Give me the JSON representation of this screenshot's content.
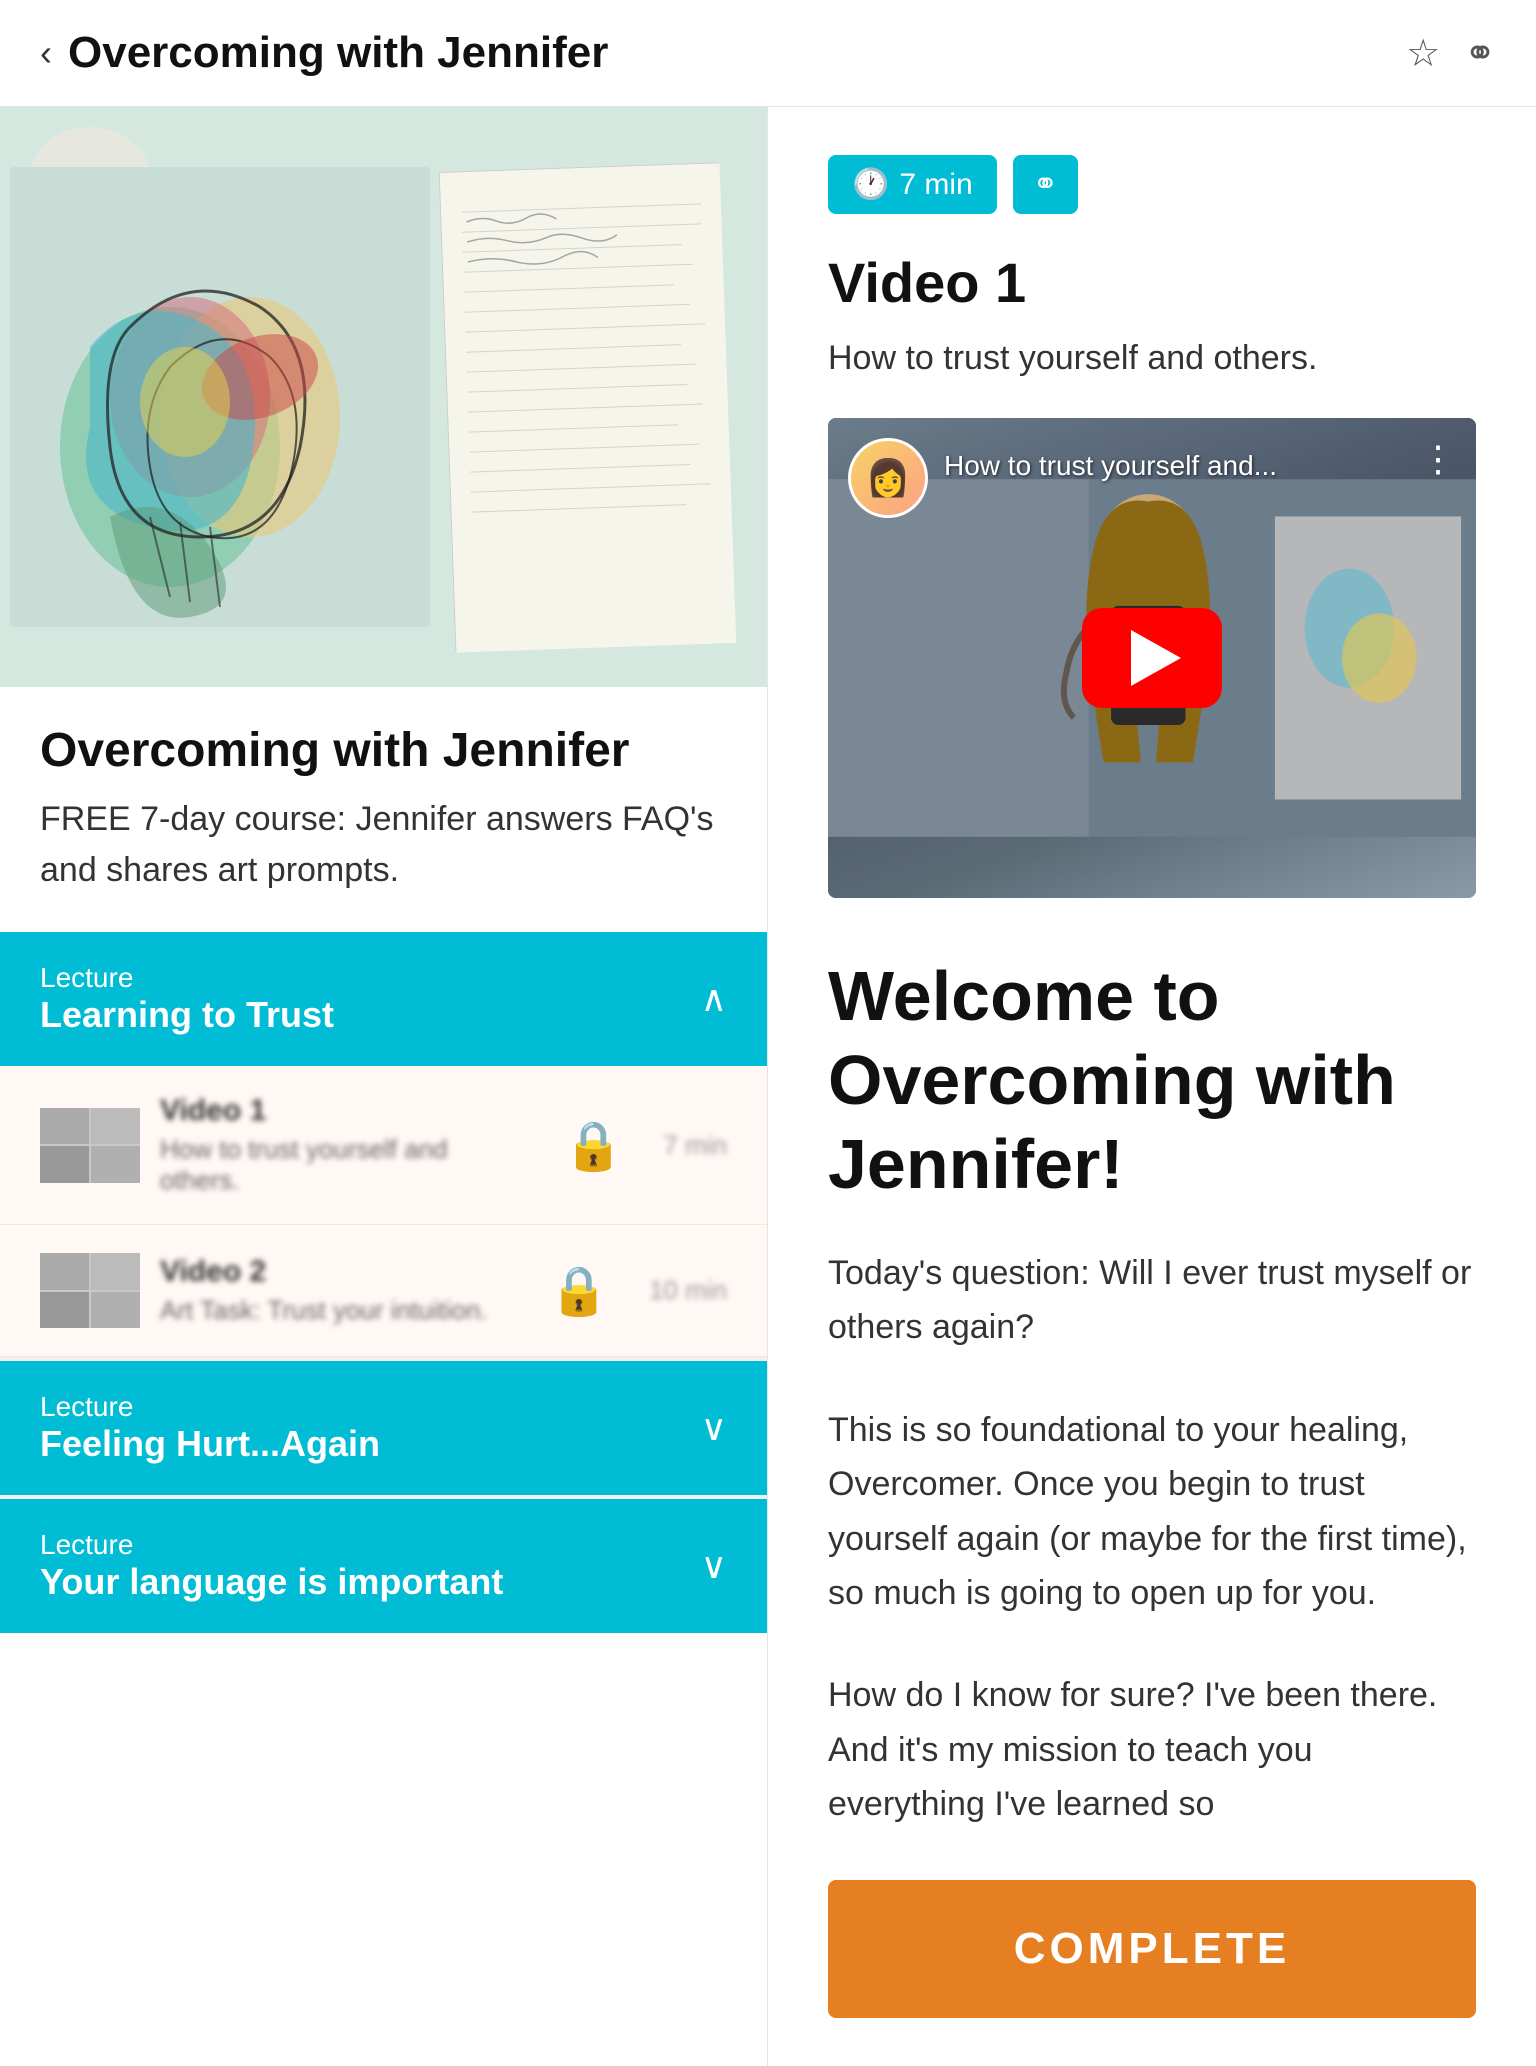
{
  "header": {
    "title": "Overcoming with Jennifer",
    "back_label": "‹",
    "bookmark_icon": "☆",
    "link_icon": "⚭"
  },
  "left": {
    "course_title": "Overcoming with Jennifer",
    "course_desc": "FREE 7-day course: Jennifer answers FAQ's and shares art prompts.",
    "lectures": [
      {
        "label": "Lecture",
        "name": "Learning to Trust",
        "expanded": true,
        "chevron": "∧"
      },
      {
        "label": "Lecture",
        "name": "Feeling Hurt...Again",
        "expanded": false,
        "chevron": "∨"
      },
      {
        "label": "Lecture",
        "name": "Your language is important",
        "expanded": false,
        "chevron": "∨"
      }
    ],
    "videos": [
      {
        "title": "Video 1",
        "desc": "How to trust yourself and others.",
        "duration": "7 min",
        "locked": true
      },
      {
        "title": "Video 2",
        "desc": "Art Task: Trust your intuition.",
        "duration": "10 min",
        "locked": true
      }
    ]
  },
  "right": {
    "tag_time": "7 min",
    "tag_time_icon": "🕐",
    "tag_link_icon": "⚭",
    "video_title": "Video 1",
    "video_subtitle": "How to trust yourself and others.",
    "yt_title": "How to trust yourself and...",
    "yt_avatar_icon": "👩",
    "yt_menu_icon": "⋮",
    "welcome_heading": "Welcome to Overcoming with Jennifer!",
    "welcome_text1": "Today's question: Will I ever trust myself or others again?",
    "welcome_text2": "This is so foundational to your healing, Overcomer. Once you begin to trust yourself again (or maybe for the first time), so much is going to open up for you.",
    "welcome_text3": "How do I know for sure? I've been there. And it's my mission to teach you everything I've learned so",
    "complete_label": "COMPLETE"
  }
}
